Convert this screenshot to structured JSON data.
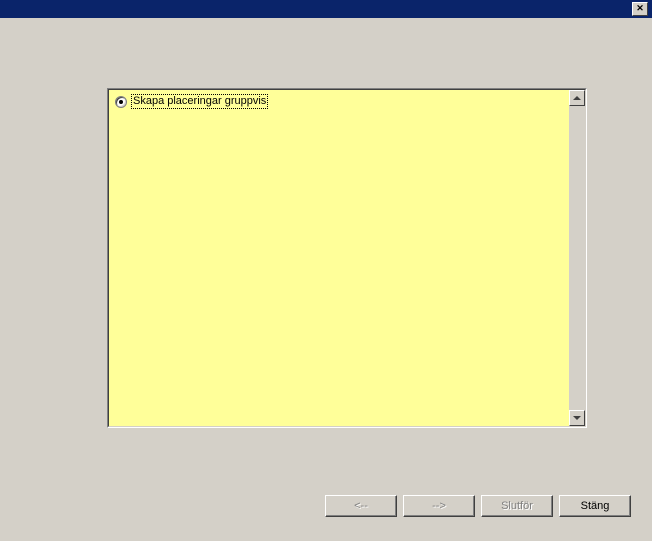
{
  "options": {
    "create_group_placements": "Skapa placeringar gruppvis"
  },
  "buttons": {
    "back": "<--",
    "next": "-->",
    "finish": "Slutför",
    "close": "Stäng"
  }
}
